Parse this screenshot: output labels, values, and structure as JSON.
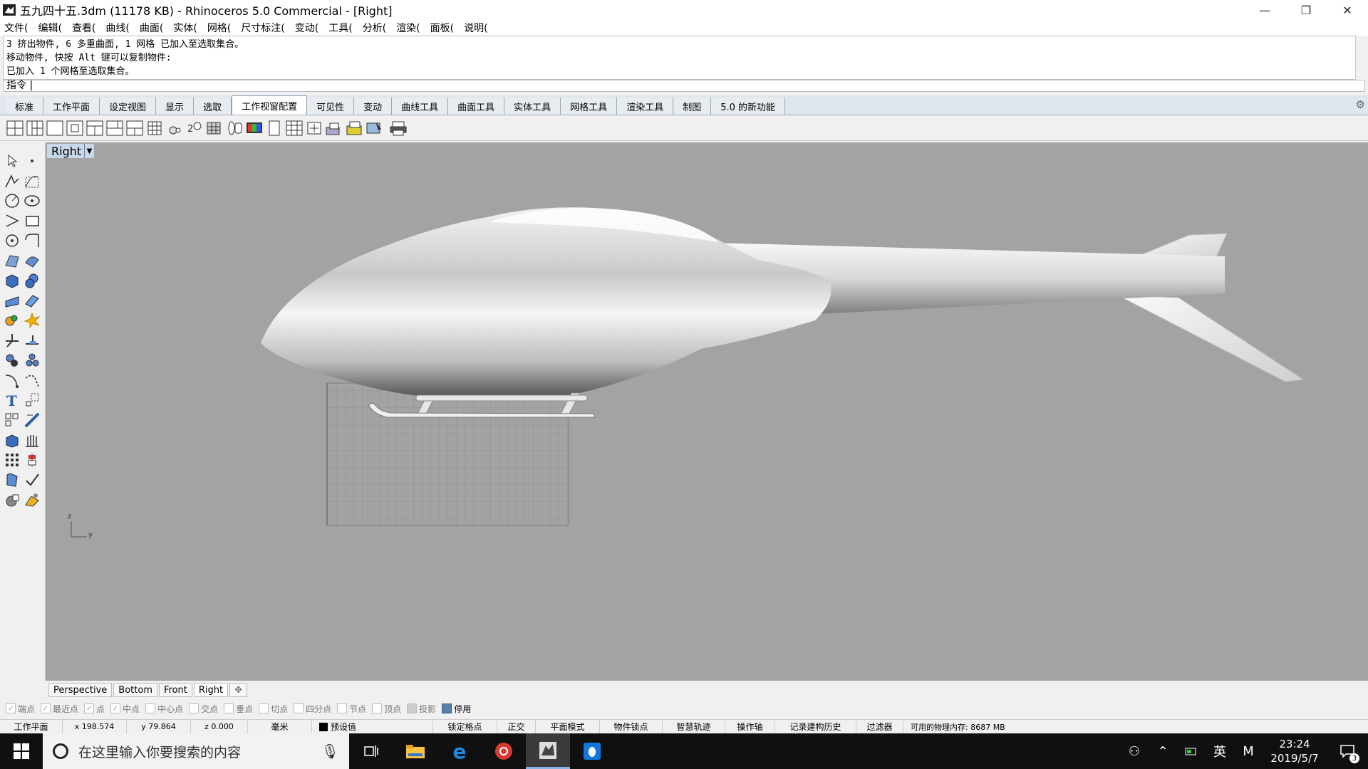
{
  "window": {
    "title": "五九四十五.3dm (11178 KB) - Rhinoceros 5.0 Commercial - [Right]",
    "minimize": "—",
    "restore": "❐",
    "close": "✕"
  },
  "menu": [
    "文件(",
    "编辑(",
    "查看(",
    "曲线(",
    "曲面(",
    "实体(",
    "网格(",
    "尺寸标注(",
    "变动(",
    "工具(",
    "分析(",
    "渲染(",
    "面板(",
    "说明("
  ],
  "command": {
    "history": [
      "3 挤出物件, 6 多重曲面, 1 网格 已加入至选取集合。",
      "移动物件, 快按 Alt 键可以复制物件:",
      "已加入 1 个网格至选取集合。"
    ],
    "prompt": "指令"
  },
  "tabs": [
    "标准",
    "工作平面",
    "设定视图",
    "显示",
    "选取",
    "工作视窗配置",
    "可见性",
    "变动",
    "曲线工具",
    "曲面工具",
    "实体工具",
    "网格工具",
    "渲染工具",
    "制图",
    "5.0 的新功能"
  ],
  "active_tab": "工作视窗配置",
  "viewport": {
    "label": "Right",
    "axis_z": "z",
    "axis_y": "y"
  },
  "viewport_tabs": [
    "Perspective",
    "Bottom",
    "Front",
    "Right"
  ],
  "viewport_tab_add": "✥",
  "osnap": [
    {
      "label": "端点",
      "on": false
    },
    {
      "label": "最近点",
      "on": false
    },
    {
      "label": "点",
      "on": false
    },
    {
      "label": "中点",
      "on": false
    },
    {
      "label": "中心点",
      "on": false
    },
    {
      "label": "交点",
      "on": false
    },
    {
      "label": "垂点",
      "on": false
    },
    {
      "label": "切点",
      "on": false
    },
    {
      "label": "四分点",
      "on": false
    },
    {
      "label": "节点",
      "on": false
    },
    {
      "label": "顶点",
      "on": false
    },
    {
      "label": "投影",
      "on": false
    },
    {
      "label": "停用",
      "on": true
    }
  ],
  "status": {
    "cplane": "工作平面",
    "x": "x 198.574",
    "y": "y 79.864",
    "z": "z 0.000",
    "units": "毫米",
    "layer": "预设值",
    "grid_snap": "锁定格点",
    "ortho": "正交",
    "planar": "平面模式",
    "osnap": "物件锁点",
    "smarttrack": "智慧轨迹",
    "gumball": "操作轴",
    "history": "记录建构历史",
    "filter": "过滤器",
    "memory": "可用的物理内存: 8687 MB"
  },
  "taskbar": {
    "search_placeholder": "在这里输入你要搜索的内容",
    "ime": "英",
    "ime2": "M",
    "time": "23:24",
    "date": "2019/5/7",
    "notif_count": "3"
  }
}
